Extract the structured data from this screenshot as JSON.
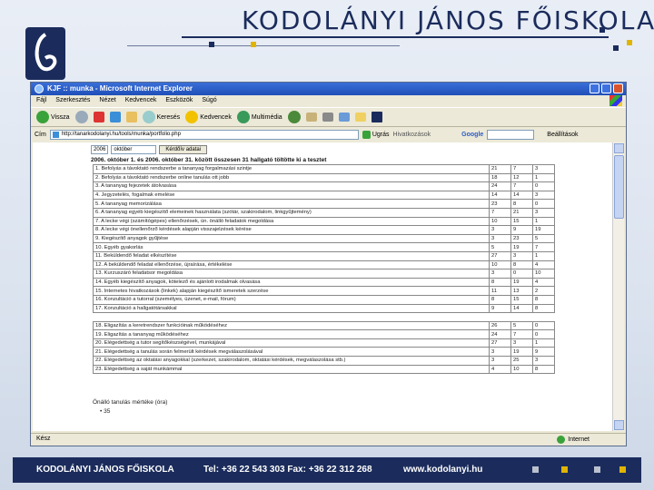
{
  "slide": {
    "title": "KODOLÁNYI JÁNOS FŐISKOLA",
    "colors": {
      "navy": "#1b2c5c",
      "accent": "#e0b400"
    }
  },
  "browser": {
    "window_title": "KJF :: munka - Microsoft Internet Explorer",
    "menu": [
      "Fájl",
      "Szerkesztés",
      "Nézet",
      "Kedvencek",
      "Eszközök",
      "Súgó"
    ],
    "toolbar": {
      "back": "Vissza",
      "search": "Keresés",
      "favorites": "Kedvencek",
      "media": "Multimédia"
    },
    "address_label": "Cím",
    "address_value": "http://tanarkodolanyi.hu/tools/munka/portfolio.php",
    "go_label": "Ugrás",
    "links_label": "Hivatkozások",
    "google_label": "Google",
    "settings_label": "Beállítások",
    "status_left": "Kész",
    "status_right": "Internet"
  },
  "page": {
    "year_select": "2006",
    "month_select": "október",
    "submit_label": "Kérdőív adatai",
    "summary": "2006. október 1. és 2006. október 31. között összesen 31 hallgató töltötte ki a tesztet",
    "rows": [
      {
        "q": "1. Befolyás a távoktató rendszerbe a tananyag forgalmazási szintje",
        "a": "21",
        "b": "7",
        "c": "3"
      },
      {
        "q": "2. Befolyás a távoktató rendszerbe online tanulás ott jobb",
        "a": "18",
        "b": "12",
        "c": "1"
      },
      {
        "q": "3. A tananyag fejezetek átolvasása",
        "a": "24",
        "b": "7",
        "c": "0"
      },
      {
        "q": "4. Jegyzetelés, fogalmak emelése",
        "a": "14",
        "b": "14",
        "c": "3"
      },
      {
        "q": "5. A tananyag memorizálása",
        "a": "23",
        "b": "8",
        "c": "0"
      },
      {
        "q": "6. A tananyag egyéb kiegészítő elemeinek használata (szótár, szakirodalom, linkgyűjtemény)",
        "a": "7",
        "b": "21",
        "c": "3"
      },
      {
        "q": "7. A lecke végi (számítógépes) ellenőrzések, ún. önálló feladatok megoldása",
        "a": "10",
        "b": "15",
        "c": "1"
      },
      {
        "q": "8. A lecke végi önellenőrző kérdések alapján visszajelzések kérése",
        "a": "3",
        "b": "9",
        "c": "19"
      },
      {
        "q": "9. Kiegészítő anyagok gyűjtése",
        "a": "3",
        "b": "23",
        "c": "5"
      },
      {
        "q": "10. Egyéb gyakorlás",
        "a": "5",
        "b": "19",
        "c": "7"
      },
      {
        "q": "11. Beküldendő feladat elkészítése",
        "a": "27",
        "b": "3",
        "c": "1"
      },
      {
        "q": "12. A beküldendő feladat ellenőrzése, újraírása, értékelése",
        "a": "10",
        "b": "8",
        "c": "4"
      },
      {
        "q": "13. Kurzuszáró feladatsor megoldása",
        "a": "3",
        "b": "0",
        "c": "10"
      },
      {
        "q": "14. Egyéb kiegészítő anyagok, kötelező és ajánlott irodalmak olvasása",
        "a": "8",
        "b": "19",
        "c": "4"
      },
      {
        "q": "15. Internetes hivatkozások (linkek) alapján kiegészítő ismeretek szerzése",
        "a": "11",
        "b": "13",
        "c": "2"
      },
      {
        "q": "16. Konzultáció a tutorral (személyes, üzenet, e-mail, fórum)",
        "a": "8",
        "b": "15",
        "c": "8"
      },
      {
        "q": "17. Konzultáció a hallgatótársakkal",
        "a": "9",
        "b": "14",
        "c": "8"
      },
      {
        "q": "18. Eligazítás a keretrendszer funkcióinak működéséhez",
        "a": "26",
        "b": "5",
        "c": "0"
      },
      {
        "q": "19. Eligazítás a tananyag működéséhez",
        "a": "24",
        "b": "7",
        "c": "0"
      },
      {
        "q": "20. Elégedettség a tutor segítőkészségével, munkájával",
        "a": "27",
        "b": "3",
        "c": "1"
      },
      {
        "q": "21. Elégedettség a tanulás során felmerült kérdések megválaszolásával",
        "a": "3",
        "b": "19",
        "c": "9"
      },
      {
        "q": "22. Elégedettség az oktatási anyagokkal (szerkezet, szakirodalom, oktatási kérdések, megválaszolása stb.)",
        "a": "3",
        "b": "25",
        "c": "3"
      },
      {
        "q": "23. Elégedettség a saját munkámmal",
        "a": "4",
        "b": "10",
        "c": "8"
      }
    ],
    "self_study_label": "Önálló tanulás mértéke (óra)",
    "self_study_value": "• 35"
  },
  "footer": {
    "name": "KODOLÁNYI JÁNOS FŐISKOLA",
    "contact": "Tel: +36 22 543 303  Fax: +36 22 312 268",
    "web": "www.kodolanyi.hu"
  }
}
